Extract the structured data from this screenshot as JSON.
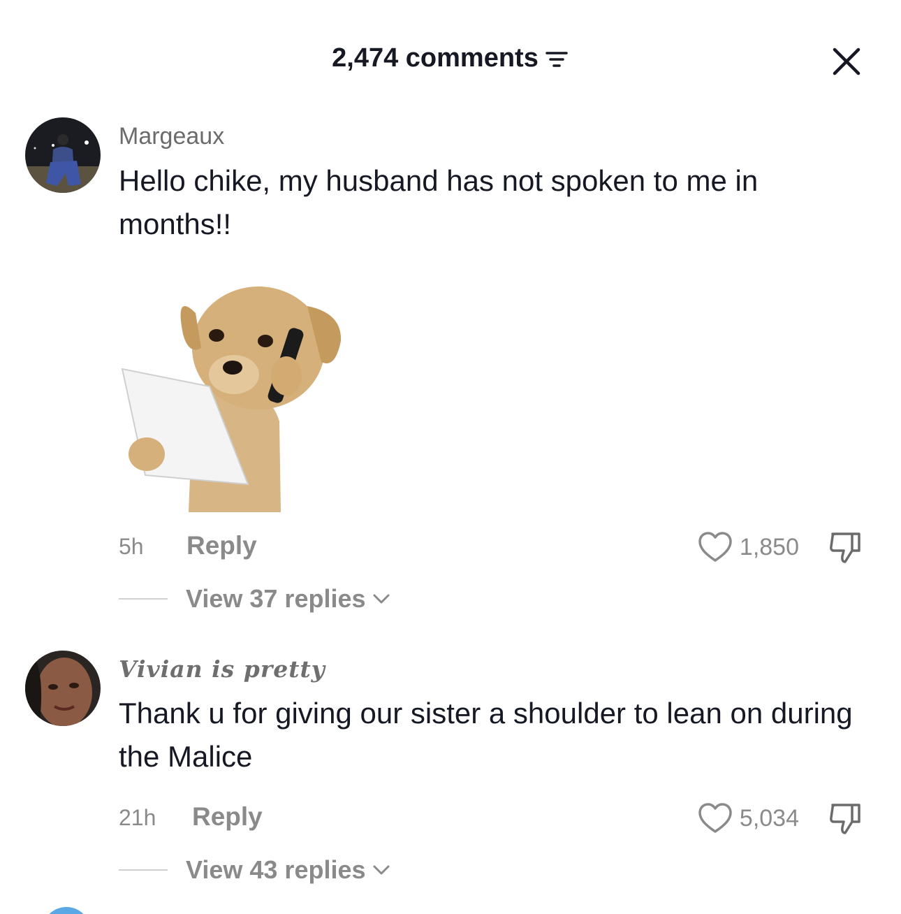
{
  "header": {
    "comments_label": "2,474 comments"
  },
  "comments": [
    {
      "username": "Margeaux",
      "text": "Hello chike, my husband has not spoken to me in months!!",
      "time": "5h",
      "reply_label": "Reply",
      "likes": "1,850",
      "view_replies": "View 37 replies"
    },
    {
      "username": "Vivian is pretty",
      "text": "Thank u for giving our sister a shoulder to lean on during the Malice",
      "time": "21h",
      "reply_label": "Reply",
      "likes": "5,034",
      "view_replies": "View 43 replies"
    }
  ],
  "colors": {
    "text_primary": "#161823",
    "text_secondary": "#8a8a8a",
    "background": "#ffffff"
  }
}
